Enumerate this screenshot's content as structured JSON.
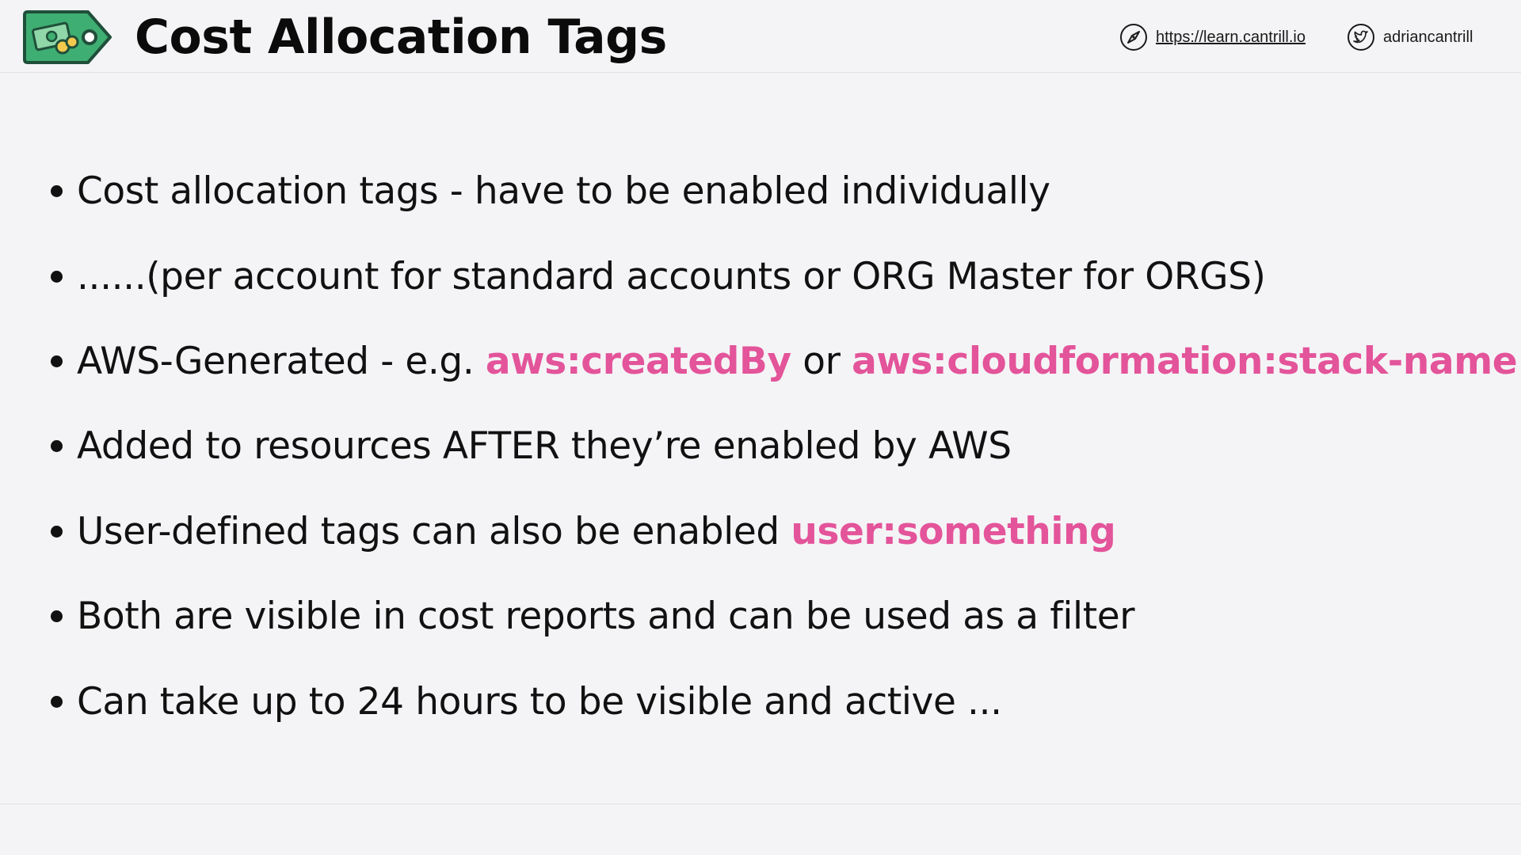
{
  "header": {
    "title": "Cost Allocation Tags",
    "site_link": "https://learn.cantrill.io",
    "twitter_handle": "adriancantrill"
  },
  "colors": {
    "background": "#f4f4f6",
    "text": "#111111",
    "highlight": "#e3549a",
    "logo_green": "#3fae72",
    "logo_green_dark": "#1f6e45"
  },
  "bullets": [
    {
      "text": "Cost allocation tags - have to be enabled individually"
    },
    {
      "text": "......(per account for standard accounts or ORG Master for ORGS)"
    },
    {
      "pre": "AWS-Generated - e.g. ",
      "hl1": "aws:createdBy",
      "mid": " or ",
      "hl2": "aws:cloudformation:stack-name"
    },
    {
      "text": "Added to resources AFTER they’re enabled by AWS"
    },
    {
      "pre": "User-defined tags can also be enabled ",
      "hl1": "user:something"
    },
    {
      "text": "Both are visible in cost reports and can be used as a filter"
    },
    {
      "text": "Can take up to 24 hours to be visible and active ..."
    }
  ],
  "icons": {
    "logo": "price-tag-with-money-icon",
    "site": "compass-icon",
    "twitter": "twitter-bird-icon"
  }
}
